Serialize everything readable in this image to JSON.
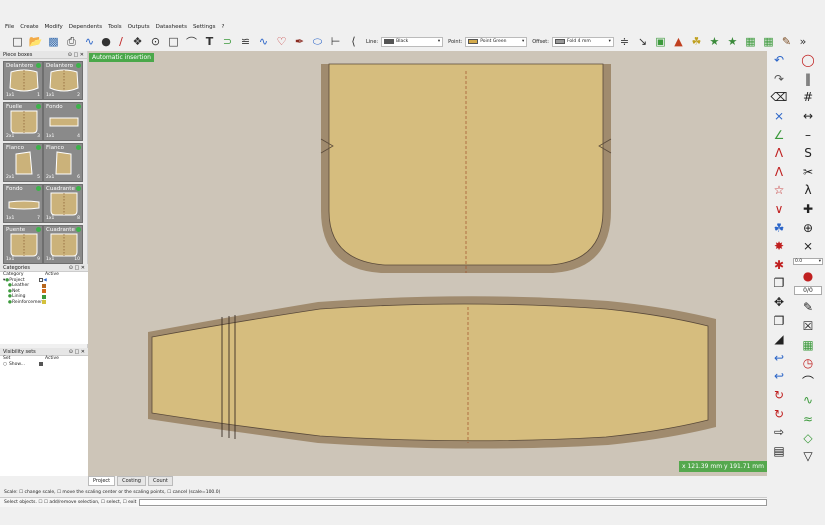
{
  "menu": [
    "File",
    "Create",
    "Modify",
    "Dependents",
    "Tools",
    "Outputs",
    "Datasheets",
    "Settings",
    "?"
  ],
  "toolbar": {
    "line_label": "Line:",
    "line_value": "Black",
    "line_color": "#555555",
    "point_label": "Point:",
    "point_value": "Point Green",
    "point_color": "#d4aa4a",
    "offset_label": "Offset:",
    "offset_value": "Fold 4 mm",
    "offset_color": "#999999"
  },
  "panels": {
    "piece_boxes": "Piece boxes",
    "categories": "Categories",
    "visibility": "Visibility sets"
  },
  "pieces": [
    {
      "name": "Delantero",
      "qty": "1x1",
      "num": "1"
    },
    {
      "name": "Delantero",
      "qty": "1x1",
      "num": "2"
    },
    {
      "name": "Fuelle",
      "qty": "2x1",
      "num": "3"
    },
    {
      "name": "Fondo",
      "qty": "1x1",
      "num": "4"
    },
    {
      "name": "Flanco",
      "qty": "2x1",
      "num": "5"
    },
    {
      "name": "Flanco",
      "qty": "2x1",
      "num": "6"
    },
    {
      "name": "Fondo",
      "qty": "1x1",
      "num": "7"
    },
    {
      "name": "Cuadrante",
      "qty": "1x1",
      "num": "8"
    },
    {
      "name": "Puente",
      "qty": "1x1",
      "num": "9"
    },
    {
      "name": "Cuadrante",
      "qty": "1x1",
      "num": "10"
    }
  ],
  "categories": {
    "header_category": "Category",
    "header_active": "Active",
    "items": [
      {
        "name": "Project",
        "color": "#ffffff"
      },
      {
        "name": "Leather",
        "color": "#b5651d"
      },
      {
        "name": "Net",
        "color": "#d46a1a"
      },
      {
        "name": "Lining",
        "color": "#3c9a3c"
      },
      {
        "name": "Reinforcement",
        "color": "#d4c13c"
      }
    ]
  },
  "visibility": {
    "header_set": "Set",
    "header_active": "Active",
    "items": [
      {
        "name": "Show..."
      }
    ]
  },
  "canvas": {
    "auto_label": "Automatic insertion",
    "coordinates": "x 121.39 mm  y 191.71 mm"
  },
  "right_panel": {
    "zoom": "0.0",
    "counter": "0/0"
  },
  "tabs": [
    "Project",
    "Costing",
    "Count"
  ],
  "status": {
    "line1": "Scale: ☐ change scale, ☐ move the scaling center or the scaling points, ☐ cancel (scale=100.0)",
    "line2": "Select objects. ☐ ☐ add/remove selection, ☐ select, ☐ exit"
  },
  "colors": {
    "canvas_bg": "#cdc5b8",
    "piece_fill": "#d9c185",
    "piece_outline": "#a08b6e",
    "accent_green": "#4aa84a"
  }
}
